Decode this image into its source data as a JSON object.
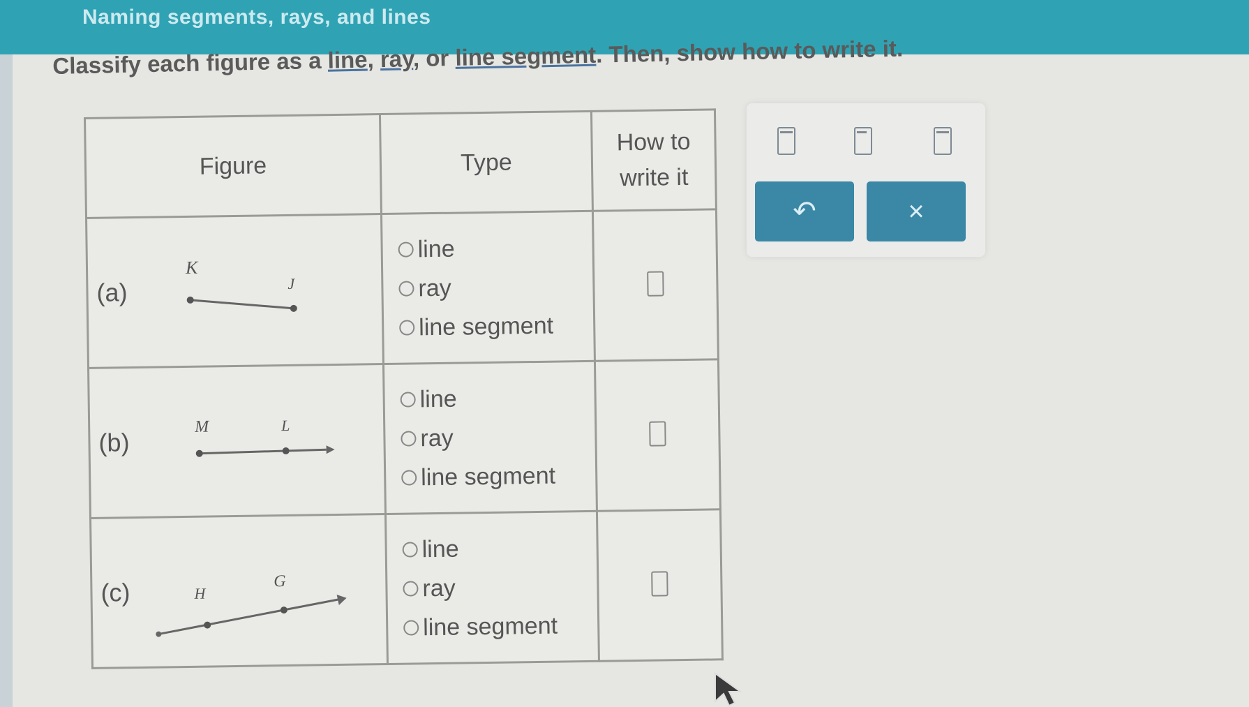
{
  "header": {
    "title": "Naming segments, rays, and lines"
  },
  "instructions": {
    "prefix": "Classify each figure as a ",
    "link_line": "line",
    "sep1": ", ",
    "link_ray": "ray",
    "sep2": ", or ",
    "link_segment": "line segment",
    "suffix": ". Then, show how to write it."
  },
  "table": {
    "headers": {
      "figure": "Figure",
      "type": "Type",
      "how_to_write": "How to write it"
    },
    "options": [
      "line",
      "ray",
      "line segment"
    ],
    "rows": [
      {
        "label": "(a)",
        "point1": "K",
        "point2": "J"
      },
      {
        "label": "(b)",
        "point1": "M",
        "point2": "L"
      },
      {
        "label": "(c)",
        "point1": "H",
        "point2": "G"
      }
    ]
  },
  "palette": {
    "icons": [
      "line-segment-notation-icon",
      "ray-notation-icon",
      "line-notation-icon"
    ],
    "undo_label": "↶",
    "clear_label": "×"
  },
  "colors": {
    "header": "#2fa3b3",
    "button": "#3b87a6",
    "background": "#e6e6e3"
  }
}
